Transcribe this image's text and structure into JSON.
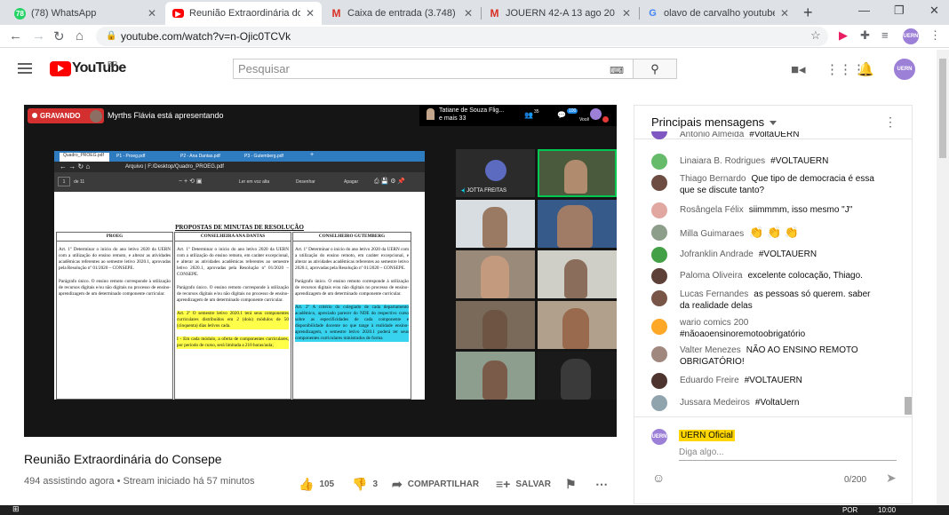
{
  "browser": {
    "tabs": [
      {
        "title": "(78) WhatsApp",
        "icon": "whatsapp-icon",
        "color": "#25d366",
        "active": false
      },
      {
        "title": "Reunião Extraordinária do",
        "icon": "youtube-icon",
        "color": "#ff0000",
        "active": true
      },
      {
        "title": "Caixa de entrada (3.748) - age",
        "icon": "gmail-icon",
        "color": "#d93025",
        "active": false
      },
      {
        "title": "JOUERN 42-A 13 ago 20 - luzi",
        "icon": "gmail-icon",
        "color": "#d93025",
        "active": false
      },
      {
        "title": "olavo de carvalho youtube - Pe",
        "icon": "google-icon",
        "color": "#4285f4",
        "active": false
      }
    ],
    "url": "youtube.com/watch?v=n-Ojic0TCVk"
  },
  "youtube": {
    "logo_text": "YouTube",
    "country": "BR",
    "search_placeholder": "Pesquisar",
    "account_initials": "UERN"
  },
  "player": {
    "recording_label": "GRAVANDO",
    "presenter_text": "Myrths Flávia está apresentando",
    "top_participant": "Tatiane de Souza Flig...",
    "top_participant_more": "e mais 33",
    "participants_count": "35",
    "chat_badge": "100",
    "self_label": "Você",
    "pdf": {
      "tabs": [
        "Quadro_PROEG.pdf",
        "P1 - Proeg.pdf",
        "P2 - Ana Dantas.pdf",
        "P3 - Gutemberg.pdf"
      ],
      "address": "Arquivo | F:/Desktop/Quadro_PROEG.pdf",
      "page_num": "1",
      "page_total": "de 11",
      "read_aloud": "Ler em voz alta",
      "draw": "Desenhar",
      "erase": "Apagar",
      "doc_title": "PROPOSTAS DE MINUTAS DE RESOLUÇÃO",
      "columns": [
        {
          "header": "PROEG",
          "paragraphs": [
            "Art. 1º Determinar o início do ano letivo 2020 da UERN com a utilização do ensino remoto, e alterar as atividades acadêmicas referentes ao semestre letivo 2020.1, aprovadas pela Resolução nº 01/2020 – CONSEPE.",
            "Parágrafo único. O ensino remoto corresponde à utilização de recursos digitais e/ou não digitais no processo de ensino-aprendizagem de um determinado componente curricular."
          ]
        },
        {
          "header": "CONSELHEIRA ANA DANTAS",
          "paragraphs": [
            "Art. 1º Determinar o início do ano letivo 2020 da UERN com a utilização do ensino remoto, em caráter excepcional, e alterar as atividades acadêmicas referentes ao semestre letivo 2020.1, aprovadas pela Resolução nº 01/2020 – CONSEPE.",
            "Parágrafo único. O ensino remoto corresponde à utilização de recursos digitais e/ou não digitais no processo de ensino-aprendizagem de um determinado componente curricular.",
            "Art. 2º O semestre letivo 2020.1 terá seus componentes curriculares distribuídos em 2 (dois) módulos de 50 (cinquenta) dias letivos cada.",
            "I - Em cada módulo, a oferta de componentes curriculares, por período de curso, será limitada a 210 horas/aula;"
          ]
        },
        {
          "header": "CONSELHEIRO GUTEMBERG",
          "paragraphs": [
            "Art. 1º Determinar o início do ano letivo 2020 da UERN com a utilização do ensino remoto, em caráter excepcional, e alterar as atividades acadêmicas referentes ao semestre letivo 2020.1, aprovadas pela Resolução nº 01/2020 – CONSEPE.",
            "Parágrafo único. O ensino remoto corresponde à utilização de recursos digitais e/ou não digitais no processo de ensino-aprendizagem de um determinado componente curricular.",
            "Art. 2º A critério do colegiado de cada departamento acadêmico, apreciado parecer do NDE do respectivo curso sobre as especificidades de cada componente e disponibilidade docente no que tange à realidade ensino-aprendizagem, o semestre letivo 2020.1 poderá ter seus componentes curriculares ministrados de forma"
          ]
        }
      ]
    },
    "active_speaker": "JOTTA FREITAS"
  },
  "video": {
    "title": "Reunião Extraordinária do Consepe",
    "meta": "494 assistindo agora • Stream iniciado há 57 minutos",
    "likes": "105",
    "dislikes": "3",
    "share": "COMPARTILHAR",
    "save": "SALVAR"
  },
  "chat": {
    "title": "Principais mensagens",
    "messages": [
      {
        "author": "Antonio Almeida",
        "text": "#VoltaUERN",
        "color": "#7e57c2"
      },
      {
        "author": "Linaiara B. Rodrigues",
        "text": "#VOLTAUERN",
        "color": "#66bb6a"
      },
      {
        "author": "Thiago Bernardo",
        "text": "Que tipo de democracia é essa que se discute tanto?",
        "color": "#6d4c41"
      },
      {
        "author": "Rosângela Félix",
        "text": "siimmmm, isso mesmo \"J\"",
        "color": "#e0a8a0"
      },
      {
        "author": "Milla Guimaraes",
        "text": "👏 👏 👏",
        "color": "#8d9e8a"
      },
      {
        "author": "Jofranklin Andrade",
        "text": "#VOLTAUERN",
        "color": "#43a047"
      },
      {
        "author": "Paloma Oliveira",
        "text": "excelente colocação, Thiago.",
        "color": "#5d4037"
      },
      {
        "author": "Lucas Fernandes",
        "text": "as pessoas só querem. saber da realidade delas",
        "color": "#795548"
      },
      {
        "author": "wario comics 200",
        "text": "#nãoaoensinoremotoobrigatório",
        "color": "#ffa726"
      },
      {
        "author": "Valter Menezes",
        "text": "NÃO AO ENSINO REMOTO OBRIGATÓRIO!",
        "color": "#a1887f"
      },
      {
        "author": "Eduardo Freire",
        "text": "#VOLTAUERN",
        "color": "#4e342e"
      },
      {
        "author": "Jussara Medeiros",
        "text": "#VoltaUern",
        "color": "#90a4ae"
      }
    ],
    "current_user": "UERN Oficial",
    "input_placeholder": "Diga algo...",
    "char_counter": "0/200"
  },
  "taskbar": {
    "lang": "POR",
    "time": "10:00"
  }
}
